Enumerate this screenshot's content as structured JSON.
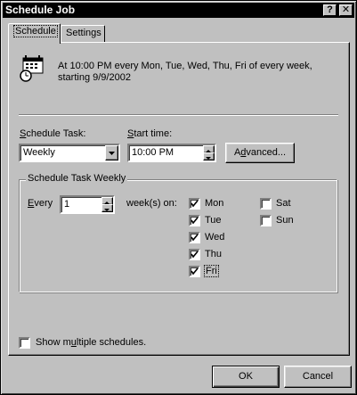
{
  "window": {
    "title": "Schedule Job"
  },
  "title_buttons": {
    "help": "?",
    "close": "✕"
  },
  "tabs": [
    {
      "label": "Schedule"
    },
    {
      "label": "Settings"
    }
  ],
  "summary": {
    "line1": "At 10:00 PM every Mon, Tue, Wed, Thu, Fri of every week,",
    "line2": "starting 9/9/2002"
  },
  "schedule_task": {
    "label_pre": "",
    "label_ul": "S",
    "label_post": "chedule Task:",
    "value": "Weekly"
  },
  "start_time": {
    "label_pre": "",
    "label_ul": "S",
    "label_post": "tart time:",
    "value": "10:00 PM"
  },
  "advanced_button": {
    "label_pre": "A",
    "label_ul": "d",
    "label_post": "vanced..."
  },
  "weekly_group": {
    "label": "Schedule Task Weekly",
    "every_label_pre": "",
    "every_label_ul": "E",
    "every_label_post": "very",
    "every_value": "1",
    "weeks_on_label": "week(s) on:",
    "days": [
      {
        "label": "Mon",
        "checked": true
      },
      {
        "label": "Tue",
        "checked": true
      },
      {
        "label": "Wed",
        "checked": true
      },
      {
        "label": "Thu",
        "checked": true
      },
      {
        "label": "Fri",
        "checked": true
      },
      {
        "label": "Sat",
        "checked": false
      },
      {
        "label": "Sun",
        "checked": false
      }
    ]
  },
  "show_multiple": {
    "label_pre": "Show m",
    "label_ul": "u",
    "label_post": "ltiple schedules.",
    "checked": false
  },
  "ok_button": {
    "label": "OK"
  },
  "cancel_button": {
    "label": "Cancel"
  }
}
